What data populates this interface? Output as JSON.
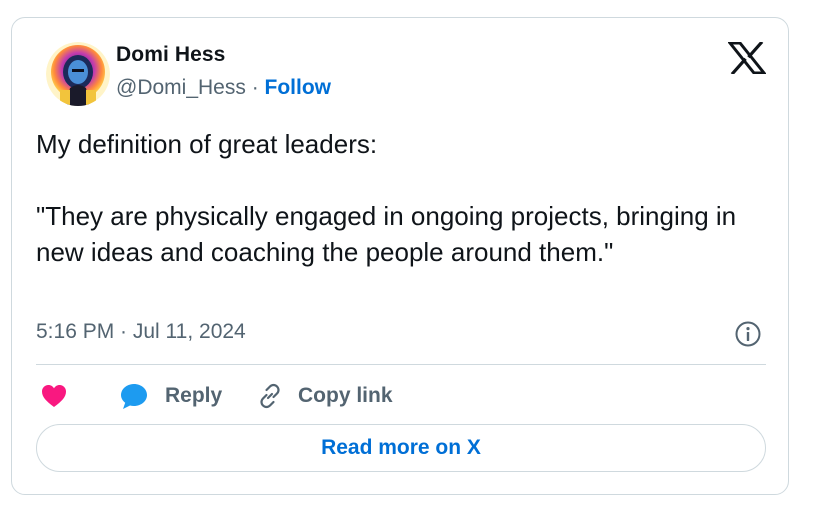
{
  "author": {
    "name": "Domi Hess",
    "handle": "@Domi_Hess",
    "separator": " · ",
    "follow_label": "Follow"
  },
  "tweet": {
    "text": "My definition of great leaders:\n\n\"They are physically engaged in ongoing projects, bringing in new ideas and coaching the people around them.\"",
    "timestamp": "5:16 PM · Jul 11, 2024"
  },
  "actions": {
    "like_icon": "heart-icon",
    "reply_label": "Reply",
    "copy_link_label": "Copy link"
  },
  "footer": {
    "read_more_label": "Read more on X"
  },
  "icons": {
    "brand": "x-logo-icon",
    "info": "info-icon",
    "reply": "speech-bubble-icon",
    "copy": "link-icon"
  },
  "colors": {
    "link": "#006fd6",
    "like": "#f91880",
    "reply": "#1d9bf0",
    "secondary_text": "#536471",
    "border": "#cfd9de"
  }
}
